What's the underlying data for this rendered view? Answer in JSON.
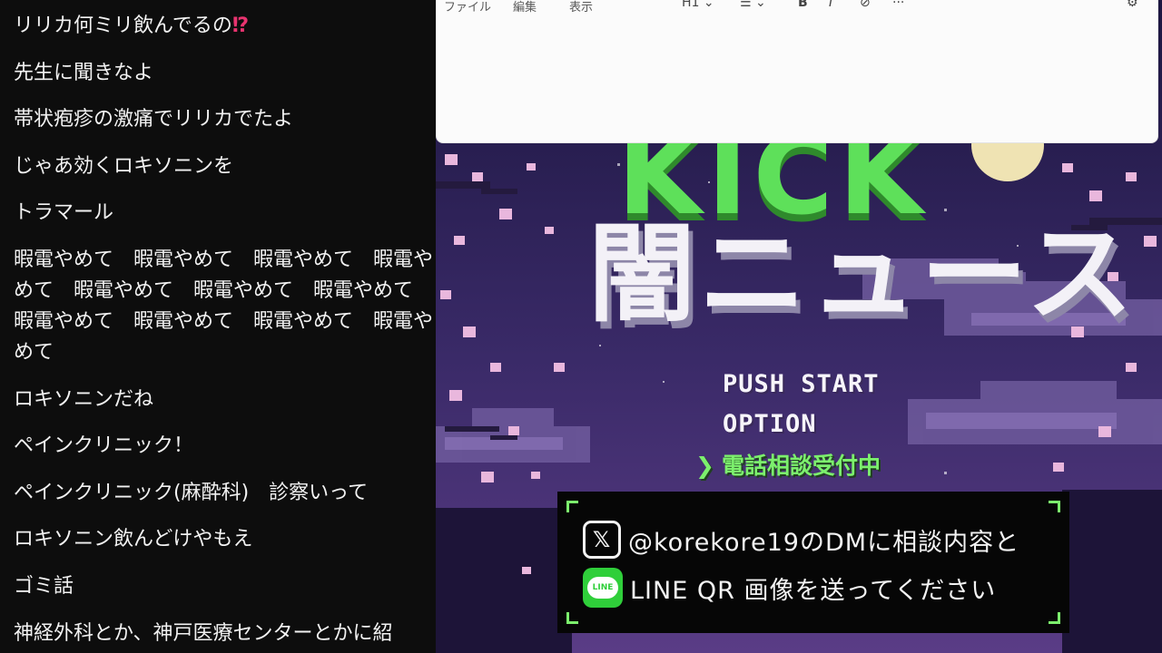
{
  "chat": {
    "messages": [
      {
        "text": "リリカ何ミリ飲んでるの",
        "emoji": "⁉"
      },
      {
        "text": "先生に聞きなよ"
      },
      {
        "text": "帯状疱疹の激痛でリリカでたよ"
      },
      {
        "text": "じゃあ効くロキソニンを"
      },
      {
        "text": "トラマール"
      },
      {
        "text": "暇電やめて　暇電やめて　暇電やめて　暇電やめて　暇電やめて　暇電やめて　暇電やめて　暇電やめて　暇電やめて　暇電やめて　暇電やめて"
      },
      {
        "text": "ロキソニンだね"
      },
      {
        "text": "ペインクリニック！"
      },
      {
        "text": "ペインクリニック(麻酔科)　診察いって"
      },
      {
        "text": "ロキソニン飲んどけやもえ"
      },
      {
        "text": "ゴミ話"
      },
      {
        "text": "神経外科とか、神戸医療センターとかに紹"
      }
    ]
  },
  "editor": {
    "menu": [
      "ファイル",
      "編集",
      "表示"
    ],
    "heading_label": "H1",
    "list_icon": "list-icon",
    "bold_label": "B",
    "italic_label": "I",
    "more_label": "···"
  },
  "game": {
    "title_top": "KICK",
    "title_main": "闇ニュース",
    "menu_start": "PUSH START",
    "menu_option": "OPTION",
    "consult_arrow": "❯",
    "consult_text": "電話相談受付中",
    "contact_x_text": "@korekore19のDMに相談内容と",
    "contact_line_text": "LINE QR 画像を送ってください",
    "x_logo": "𝕏",
    "line_logo_text": "LINE",
    "colors": {
      "green": "#7cf06d",
      "title_green": "#5ee05a",
      "purple": "#2a1d4e",
      "pink": "#e8b6dc"
    }
  }
}
